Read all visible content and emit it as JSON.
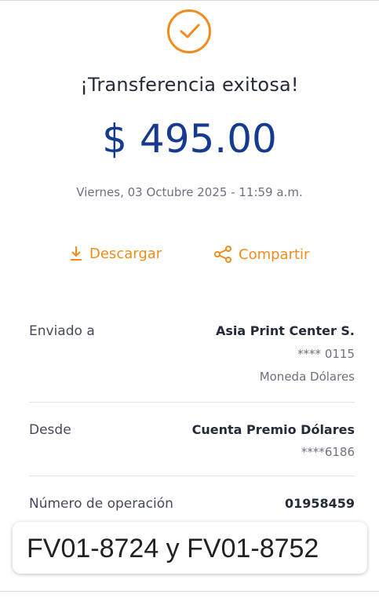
{
  "header": {
    "title": "¡Transferencia exitosa!"
  },
  "transfer": {
    "amount": "$ 495.00",
    "datetime": "Viernes, 03 Octubre 2025 - 11:59 a.m."
  },
  "actions": {
    "download_label": "Descargar",
    "share_label": "Compartir"
  },
  "details": {
    "recipient": {
      "label": "Enviado a",
      "name": "Asia Print Center S.",
      "account": "**** 0115",
      "currency": "Moneda Dólares"
    },
    "source": {
      "label": "Desde",
      "account_name": "Cuenta Premio Dólares",
      "account": "****6186"
    },
    "operation": {
      "label": "Número de operación",
      "number": "01958459"
    }
  },
  "note": {
    "text": "FV01-8724 y FV01-8752"
  },
  "colors": {
    "accent": "#f08c1e",
    "amount": "#163a8f",
    "text": "#262b39"
  }
}
